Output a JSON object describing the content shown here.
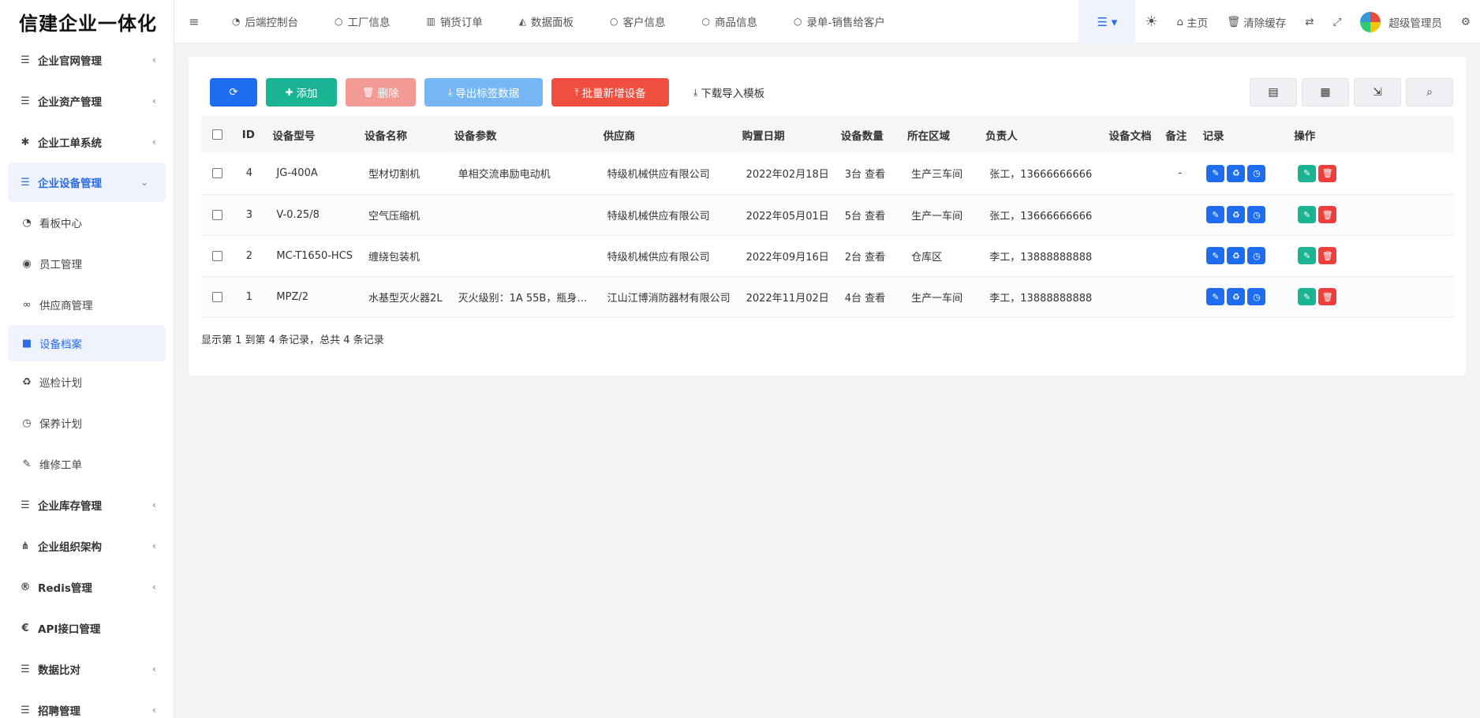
{
  "app": {
    "brand": "信建企业一体化"
  },
  "sidebar": {
    "items": [
      {
        "label": "企业官网管理",
        "icon": "list-icon",
        "glyph": "☰",
        "type": "group"
      },
      {
        "label": "企业资产管理",
        "icon": "list-icon",
        "glyph": "☰",
        "type": "group"
      },
      {
        "label": "企业工单系统",
        "icon": "asterisk-icon",
        "glyph": "✱",
        "type": "group"
      },
      {
        "label": "企业设备管理",
        "icon": "list-icon",
        "glyph": "☰",
        "type": "active-group"
      },
      {
        "label": "看板中心",
        "icon": "dashboard-icon",
        "glyph": "◔",
        "type": "sub"
      },
      {
        "label": "员工管理",
        "icon": "user-icon",
        "glyph": "◉",
        "type": "sub"
      },
      {
        "label": "供应商管理",
        "icon": "handshake-icon",
        "glyph": "∞",
        "type": "sub"
      },
      {
        "label": "设备档案",
        "icon": "archive-icon",
        "glyph": "■",
        "type": "active-sub"
      },
      {
        "label": "巡检计划",
        "icon": "recycle-icon",
        "glyph": "♻",
        "type": "sub"
      },
      {
        "label": "保养计划",
        "icon": "clock-icon",
        "glyph": "◷",
        "type": "sub"
      },
      {
        "label": "维修工单",
        "icon": "wrench-icon",
        "glyph": "✎",
        "type": "sub"
      },
      {
        "label": "企业库存管理",
        "icon": "list-icon",
        "glyph": "☰",
        "type": "group"
      },
      {
        "label": "企业组织架构",
        "icon": "sitemap-icon",
        "glyph": "⋔",
        "type": "group"
      },
      {
        "label": "Redis管理",
        "icon": "registered-icon",
        "glyph": "®",
        "type": "group"
      },
      {
        "label": "API接口管理",
        "icon": "api-icon",
        "glyph": "€",
        "type": "group-nochev"
      },
      {
        "label": "数据比对",
        "icon": "list-icon",
        "glyph": "☰",
        "type": "group"
      },
      {
        "label": "招聘管理",
        "icon": "list-icon",
        "glyph": "☰",
        "type": "group"
      }
    ]
  },
  "topbar": {
    "tabs": [
      {
        "label": "后端控制台",
        "icon": "dashboard-icon",
        "glyph": "◔"
      },
      {
        "label": "工厂信息",
        "icon": "circle-icon",
        "glyph": "○"
      },
      {
        "label": "销货订单",
        "icon": "bar-chart-icon",
        "glyph": "▥"
      },
      {
        "label": "数据面板",
        "icon": "area-chart-icon",
        "glyph": "◭"
      },
      {
        "label": "客户信息",
        "icon": "circle-icon",
        "glyph": "○"
      },
      {
        "label": "商品信息",
        "icon": "circle-icon",
        "glyph": "○"
      },
      {
        "label": "录单-销售给客户",
        "icon": "circle-icon",
        "glyph": "○"
      }
    ],
    "home": "主页",
    "clear_cache": "清除缓存",
    "user": "超级管理员"
  },
  "toolbar": {
    "add": "添加",
    "delete": "删除",
    "export_labels": "导出标签数据",
    "batch_add": "批量新增设备",
    "download_template": "下载导入模板"
  },
  "table": {
    "columns": [
      "ID",
      "设备型号",
      "设备名称",
      "设备参数",
      "供应商",
      "购置日期",
      "设备数量",
      "所在区域",
      "负责人",
      "设备文档",
      "备注",
      "记录",
      "操作"
    ],
    "rows": [
      {
        "id": "4",
        "model": "JG-400A",
        "name": "型材切割机",
        "params": "单相交流串励电动机",
        "supplier": "特级机械供应有限公司",
        "date": "2022年02月18日",
        "qty": "3台 查看",
        "area": "生产三车间",
        "owner": "张工，13666666666",
        "doc": "",
        "remark": "-"
      },
      {
        "id": "3",
        "model": "V-0.25/8",
        "name": "空气压缩机",
        "params": "",
        "supplier": "特级机械供应有限公司",
        "date": "2022年05月01日",
        "qty": "5台 查看",
        "area": "生产一车间",
        "owner": "张工，13666666666",
        "doc": "",
        "remark": ""
      },
      {
        "id": "2",
        "model": "MC-T1650-HCS",
        "name": "缠绕包装机",
        "params": "",
        "supplier": "特级机械供应有限公司",
        "date": "2022年09月16日",
        "qty": "2台 查看",
        "area": "仓库区",
        "owner": "李工，13888888888",
        "doc": "",
        "remark": ""
      },
      {
        "id": "1",
        "model": "MPZ/2",
        "name": "水基型灭火器2L",
        "params": "灭火级别：1A 55B，瓶身材质...",
        "supplier": "江山江博消防器材有限公司",
        "date": "2022年11月02日",
        "qty": "4台 查看",
        "area": "生产一车间",
        "owner": "李工，13888888888",
        "doc": "",
        "remark": ""
      }
    ]
  },
  "summary": "显示第 1 到第 4 条记录，总共 4 条记录"
}
